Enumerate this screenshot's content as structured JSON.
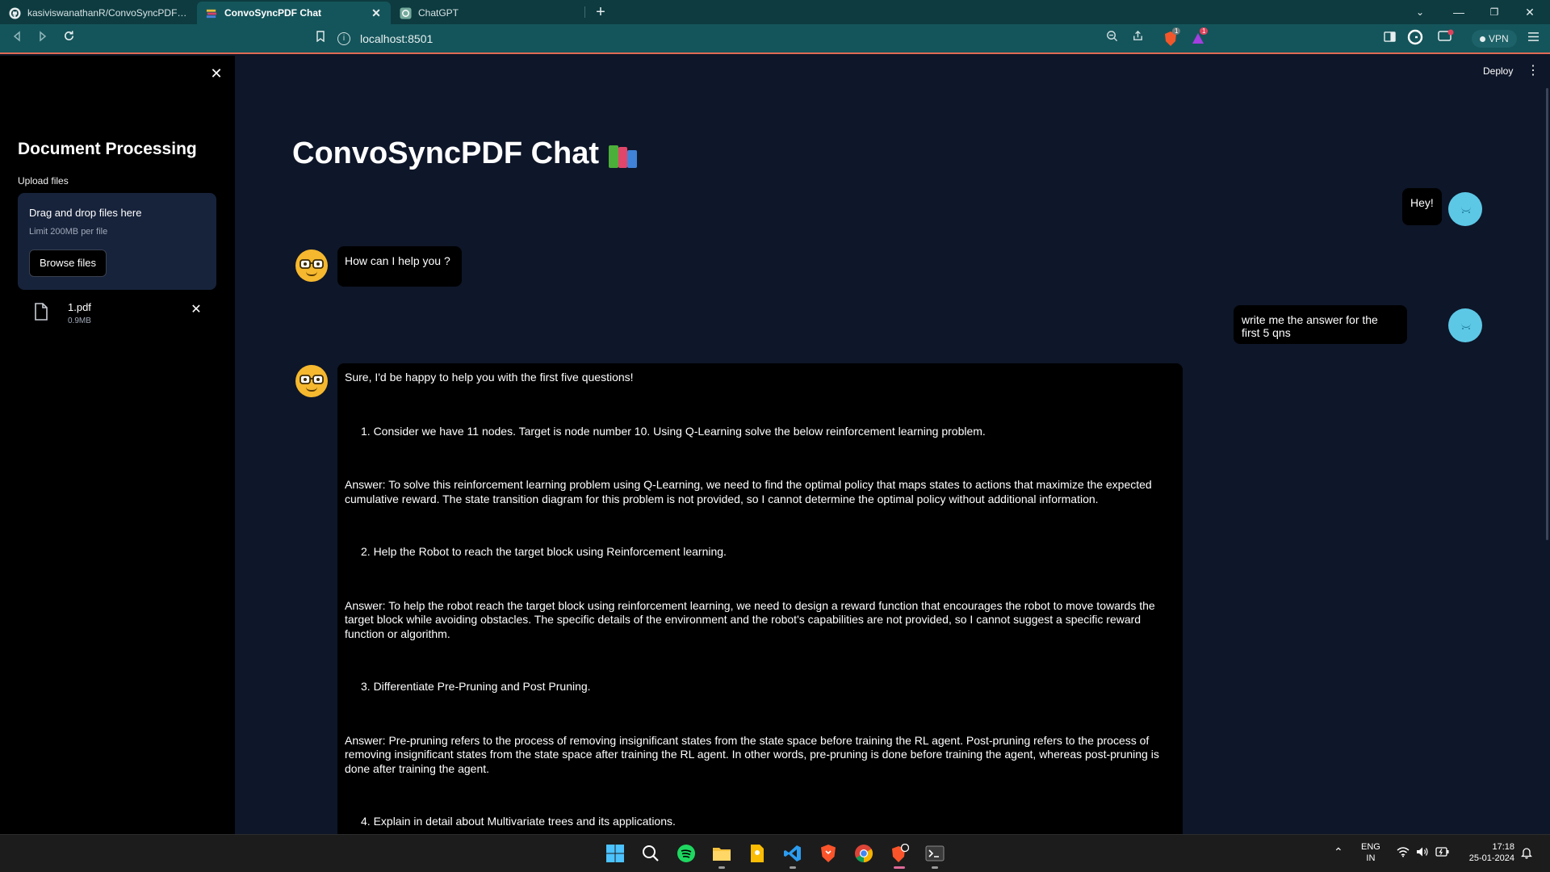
{
  "browser": {
    "tabs": [
      {
        "label": "kasiviswanathanR/ConvoSyncPDF-Chat",
        "icon": "github-icon",
        "active": false
      },
      {
        "label": "ConvoSyncPDF Chat",
        "icon": "streamlit-icon",
        "active": true
      },
      {
        "label": "ChatGPT",
        "icon": "chatgpt-icon",
        "active": false
      }
    ],
    "url": "localhost:8501",
    "vpn_label": "VPN",
    "new_tab_symbol": "+",
    "shields_count": "1",
    "rewards_count": "1"
  },
  "sidebar": {
    "title": "Document Processing",
    "upload_label": "Upload files",
    "dropzone_title": "Drag and drop files here",
    "dropzone_limit": "Limit 200MB per file",
    "browse_button": "Browse files",
    "file": {
      "name": "1.pdf",
      "size": "0.9MB"
    }
  },
  "header": {
    "deploy_label": "Deploy"
  },
  "main": {
    "title": "ConvoSyncPDF Chat",
    "messages": [
      {
        "role": "user",
        "text": "Hey!"
      },
      {
        "role": "assistant",
        "text": "How can I help you ?"
      },
      {
        "role": "user",
        "text": "write me the answer for the first 5 qns"
      }
    ],
    "answer": {
      "intro": "Sure, I'd be happy to help you with the first five questions!",
      "q1": "1. Consider we have 11 nodes. Target is node number 10. Using Q-Learning solve the below reinforcement learning problem.",
      "a1": "Answer: To solve this reinforcement learning problem using Q-Learning, we need to find the optimal policy that maps states to actions that maximize the expected cumulative reward. The state transition diagram for this problem is not provided, so I cannot determine the optimal policy without additional information.",
      "q2": "2. Help the Robot to reach the target block using Reinforcement learning.",
      "a2": "Answer: To help the robot reach the target block using reinforcement learning, we need to design a reward function that encourages the robot to move towards the target block while avoiding obstacles. The specific details of the environment and the robot's capabilities are not provided, so I cannot suggest a specific reward function or algorithm.",
      "q3": "3. Differentiate Pre-Pruning and Post Pruning.",
      "a3": "Answer: Pre-pruning refers to the process of removing insignificant states from the state space before training the RL agent. Post-pruning refers to the process of removing insignificant states from the state space after training the RL agent. In other words, pre-pruning is done before training the agent, whereas post-pruning is done after training the agent.",
      "q4": "4. Explain in detail about Multivariate trees and its applications."
    }
  },
  "taskbar": {
    "apps": [
      "windows-start-icon",
      "search-icon",
      "spotify-icon",
      "file-explorer-icon",
      "keep-notes-icon",
      "vscode-icon",
      "brave-icon",
      "chrome-icon",
      "brave-beta-icon",
      "terminal-icon"
    ],
    "language_line1": "ENG",
    "language_line2": "IN",
    "time": "17:18",
    "date": "25-01-2024"
  },
  "colors": {
    "tabbar": "#0d3b40",
    "toolbar": "#14555b",
    "sidebar": "#000000",
    "main_bg": "#0e1629",
    "bubble": "#000000",
    "bot_avatar": "#f5b82e",
    "user_avatar": "#5cc8e6"
  }
}
